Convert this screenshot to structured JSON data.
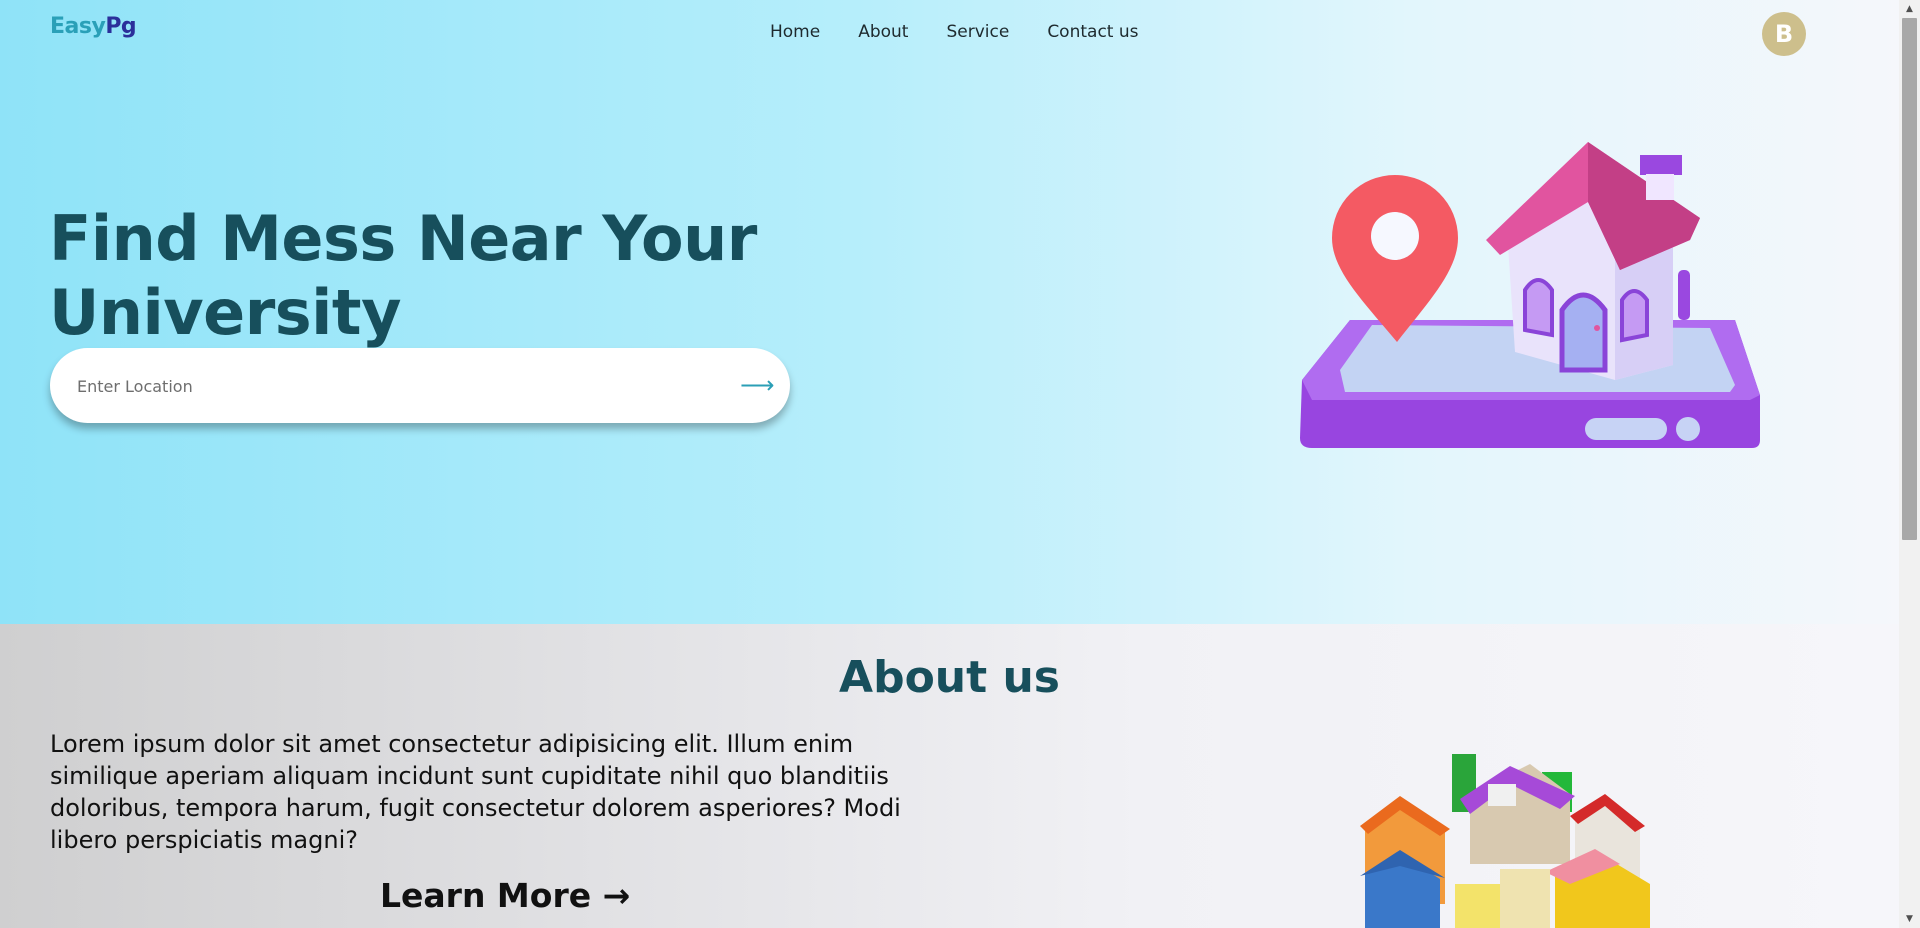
{
  "header": {
    "logo_part1": "Easy",
    "logo_part2": "Pg",
    "nav": [
      {
        "label": "Home"
      },
      {
        "label": "About"
      },
      {
        "label": "Service"
      },
      {
        "label": "Contact us"
      }
    ],
    "avatar_initial": "B"
  },
  "hero": {
    "title_line1": "Find Mess Near Your",
    "title_line2": "University",
    "search": {
      "placeholder": "Enter Location",
      "value": "",
      "submit_icon": "arrow-right-icon",
      "submit_glyph": "⟶"
    },
    "illustration": "house-with-location-pin-on-phone-illustration"
  },
  "about": {
    "title": "About us",
    "text": "Lorem ipsum dolor sit amet consectetur adipisicing elit. Illum enim similique aperiam aliquam incidunt sunt cupiditate nihil quo blanditiis doloribus, tempora harum, fugit consectetur dolorem asperiores? Modi libero perspiciatis magni?",
    "learn_more": "Learn More →",
    "illustration": "colorful-houses-cluster-illustration"
  },
  "colors": {
    "brand_teal": "#2aa0b8",
    "brand_navy": "#2b2f9a",
    "heading": "#174f5c",
    "avatar_bg": "#cdbf8c"
  }
}
